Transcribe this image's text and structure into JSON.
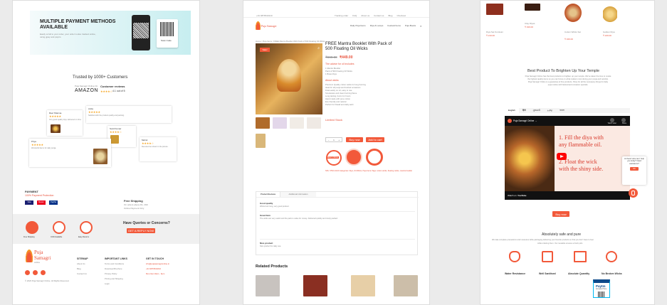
{
  "panel1": {
    "hero": {
      "title_line1": "MULTIPLE PAYMENT METHODS",
      "title_line2": "AVAILABLE",
      "sub1": "Easily scroll to your order, your order is also tracked online,",
      "sub2": "using gpay and paytm.",
      "qr_label": "Scan Code"
    },
    "trust_title": "Trusted by 1000+ Customers",
    "trust_amazon_small": "Puja Samagri Online On",
    "trust_amazon": "AMAZON",
    "trust_reviews": "Customer reviews",
    "trust_rating": "4.1 out of 5",
    "reviews": [
      {
        "name": "Ravi Sharma",
        "text": "Very good quality diya, delivered on time."
      },
      {
        "name": "Anita",
        "text": "Satisfied with the product quality and packing."
      },
      {
        "name": "Sunil Kumar",
        "text": "Nice product, value for money."
      },
      {
        "name": "Priya",
        "text": "Wonderful items for daily pooja."
      },
      {
        "name": "Mehul",
        "text": "Received as shown in the picture."
      }
    ],
    "payment_title": "PAYMENT",
    "payment_sub": "100% Payment Protection",
    "pay_methods": [
      "Visa",
      "Master",
      "PayPal"
    ],
    "shipping_title": "Free Shipping",
    "shipping_l1": "On orders above Rs. 499",
    "shipping_l2": "Online Payment Only",
    "queries_title": "Have Queries or Concerns?",
    "queries_btn": "GET A REPLY NOW",
    "feature_icons": [
      "Free Shipping",
      "COD Available",
      "Easy Returns"
    ],
    "brand1": "Puja",
    "brand2": "Samagri",
    "brand3": "online",
    "cols": [
      {
        "title": "SITEMAP",
        "items": [
          "About Us",
          "Blog",
          "Contact Us"
        ]
      },
      {
        "title": "IMPORTANT LINKS",
        "items": [
          "Terms and Conditions",
          "Download Brochure",
          "Privacy Policy",
          "Pricing and Shipping",
          "Login"
        ]
      },
      {
        "title": "GET IN TOUCH",
        "items": [
          "info@pujasamagrionline.in",
          "+91 9876543210",
          "Mon-Sat 10am - 6pm"
        ]
      }
    ],
    "copyright": "© 2023 Puja Samagri Online. All Rights Reserved."
  },
  "panel2": {
    "topbar_left": "+91 9876543210",
    "topbar_links": [
      "Tracking order",
      "FAQ",
      "About us",
      "Contact us",
      "Blog",
      "Checkout"
    ],
    "brand": "Puja Samagri",
    "nav": [
      "Daily Puja Items",
      "Diya & Lamps",
      "Festival Items",
      "Puja Books"
    ],
    "breadcrumb": "Home / Puja Items / FREE Mantra Booklet With Pack of 500 Floating Oil Wicks",
    "sale": "Sale!",
    "title_line1": "FREE Mantra Booklet With Pack of",
    "title_line2": "500 Floating Oil Wicks",
    "old_price": "₹599.00",
    "price": "₹449.00",
    "desc_title": "The advice for oil includes",
    "desc": [
      "1 Mantra Booklet",
      "Pack of 500 Floating Oil Wicks",
      "1 Brass Diya"
    ],
    "about_title": "About wicks",
    "about": [
      "Premium Quality cotton wicks for long burning",
      "Ideal for all pooja and festival occasions",
      "Float easily on oil, easy to use",
      "Smokeless and clean burning flame",
      "Long lasting, burns for hours",
      "Hand made with pure cotton",
      "Eco friendly and natural",
      "Perfect for Diwali and daily aarti"
    ],
    "stock": "Limited Stock",
    "qty_label": "1",
    "buy_now": "Buy now",
    "add_to_cart": "Add to cart",
    "best_price": "BEST PRICE",
    "meta": "SKU: PSO-1024 Categories: Diya, Oil Wicks, Puja Items Tags: cotton wicks, floating wicks, mantra booklet",
    "tabs": [
      "Product Reviews",
      "Additional information"
    ],
    "review_head1": "Good quality",
    "review_text1": "Wicks burn long, very good product.",
    "review_head2": "Great Item",
    "review_text2": "The wicks are very useful and the pack is value for money. Delivered quickly and nicely packed.",
    "review_head3": "Nice product",
    "review_text3": "Nice product for daily use.",
    "related_title": "Related Products"
  },
  "panel3": {
    "products": [
      {
        "name": "Diya Set Kumkum",
        "price": "₹ 219.00"
      },
      {
        "name": "Clay Diyas",
        "price": "₹ 199.00"
      },
      {
        "name": "Cotton Wicks Set",
        "price": "₹ 349.00"
      },
      {
        "name": "Golden Diya",
        "price": "₹ 249.00"
      }
    ],
    "section_title": "Best Product To Brighten Up Your Temple",
    "section_p1": "Puja Samagri Online has the best products to brighten up your temple. We've taken the time to curate",
    "section_p2": "the highest quality items so you can focus on what matters most during your pooja and worship.",
    "section_p3": "Puja Samagri Online is a guarantee of fine products. Shop for all the necessary things for daily",
    "section_p4": "puja routine with festival and occasion specials.",
    "lang_tabs": [
      "English",
      "हिंदी",
      "ગુજરાતી",
      "தமிழ்",
      "বাংলা"
    ],
    "video_channel": "Puja Samagri Online →",
    "video_step1a": "1. Fill the diya with",
    "video_step1b": "any flammable oil.",
    "video_step2a": "2. Float the wick",
    "video_step2b": "with the shiny side.",
    "watch_on": "Watch on",
    "youtube": "YouTube",
    "share": "Share",
    "watch_later": "Watch Later",
    "buy_now": "Buy now",
    "safe_title": "Absolutely safe and pure",
    "safe_p1": "We take complete precautions and measures while packaging delivering your favorite products so that you don't have to fear",
    "safe_p2": "while ordering them. Our reusable ensures a fresh pick.",
    "features": [
      "Water Resistance",
      "Well Sanitised",
      "Absolute Quantity",
      "No Broken Wicks"
    ],
    "paytm": "Paytm",
    "paytm_sub": "Accepted Here",
    "chat_text": "Hi there! How can I help you today? Need assistance?",
    "chat_btn": "OK"
  },
  "colors": {
    "accent": "#f2593a",
    "teal": "#c7eef0",
    "dark": "#1a1a1a"
  }
}
